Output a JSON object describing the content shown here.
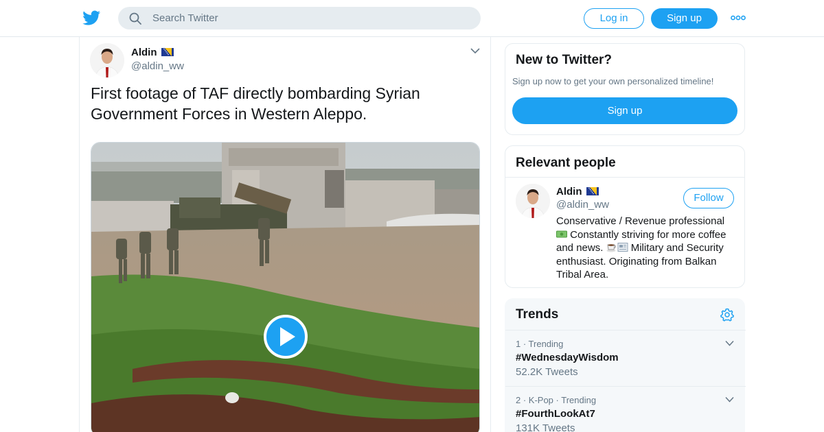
{
  "header": {
    "search_placeholder": "Search Twitter",
    "login_label": "Log in",
    "signup_label": "Sign up",
    "brand_color": "#1da1f2"
  },
  "tweet": {
    "author_name": "Aldin",
    "author_handle": "@aldin_ww",
    "text": "First footage of TAF directly bombarding Syrian Government Forces in Western Aleppo.",
    "media_type": "video"
  },
  "new_to_twitter": {
    "heading": "New to Twitter?",
    "subtext": "Sign up now to get your own personalized timeline!",
    "button_label": "Sign up"
  },
  "relevant_people": {
    "heading": "Relevant people",
    "person": {
      "name": "Aldin",
      "handle": "@aldin_ww",
      "follow_label": "Follow",
      "bio_1": "Conservative / Revenue professional",
      "bio_2": "Constantly striving for more coffee and news.",
      "bio_3": "Military and Security enthusiast. Originating from Balkan Tribal Area."
    }
  },
  "trends": {
    "heading": "Trends",
    "items": [
      {
        "meta": "1 · Trending",
        "tag": "#WednesdayWisdom",
        "count": "52.2K Tweets"
      },
      {
        "meta": "2 · K-Pop · Trending",
        "tag": "#FourthLookAt7",
        "count": "131K Tweets"
      }
    ]
  }
}
